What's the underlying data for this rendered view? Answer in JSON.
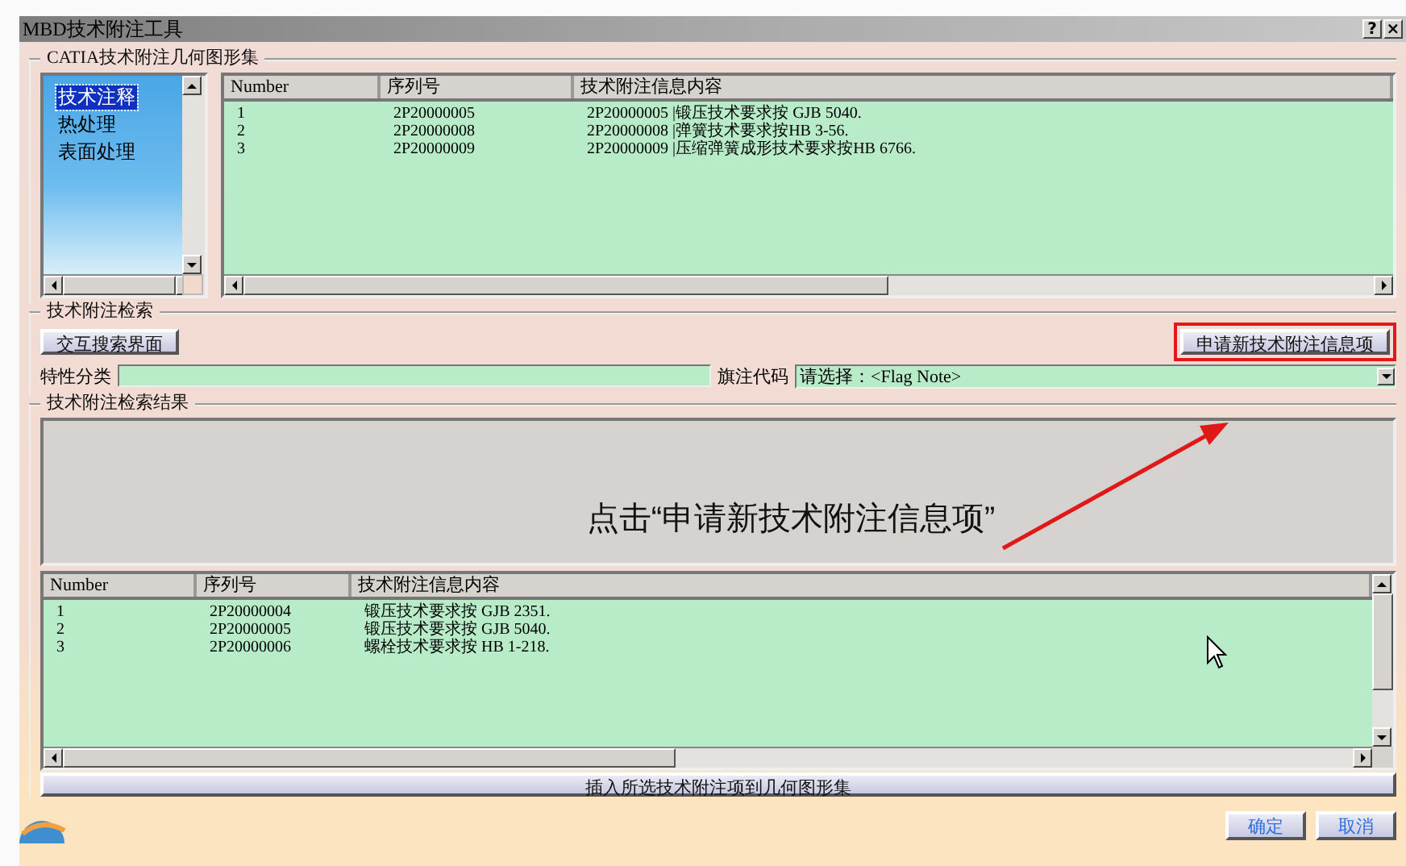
{
  "window": {
    "title": "MBD技术附注工具",
    "help_button": "?",
    "close_button": "×"
  },
  "geometry_set": {
    "title": "CATIA技术附注几何图形集",
    "categories": [
      {
        "label": "技术注释",
        "selected": true
      },
      {
        "label": "热处理",
        "selected": false
      },
      {
        "label": "表面处理",
        "selected": false
      }
    ],
    "table": {
      "columns": [
        "Number",
        "序列号",
        "技术附注信息内容"
      ],
      "rows": [
        [
          "1",
          "2P20000005",
          "2P20000005 |锻压技术要求按 GJB 5040."
        ],
        [
          "2",
          "2P20000008",
          "2P20000008 |弹簧技术要求按HB 3-56."
        ],
        [
          "3",
          "2P20000009",
          "2P20000009 |压缩弹簧成形技术要求按HB 6766."
        ]
      ]
    }
  },
  "search": {
    "title": "技术附注检索",
    "interactive_button": "交互搜索界面",
    "apply_button": {
      "label": "申请新技术附注信息项",
      "highlighted": true
    },
    "property_label": "特性分类",
    "flag_label": "旗注代码",
    "flag_value": "请选择：<Flag Note>"
  },
  "results": {
    "title": "技术附注检索结果",
    "annotation": "点击“申请新技术附注信息项”",
    "table": {
      "columns": [
        "Number",
        "序列号",
        "技术附注信息内容"
      ],
      "rows": [
        [
          "1",
          "2P20000004",
          "锻压技术要求按 GJB 2351."
        ],
        [
          "2",
          "2P20000005",
          "锻压技术要求按 GJB 5040."
        ],
        [
          "3",
          "2P20000006",
          "螺栓技术要求按 HB 1-218."
        ]
      ]
    },
    "insert_button": "插入所选技术附注项到几何图形集"
  },
  "buttons": [
    "确定",
    "取消"
  ]
}
